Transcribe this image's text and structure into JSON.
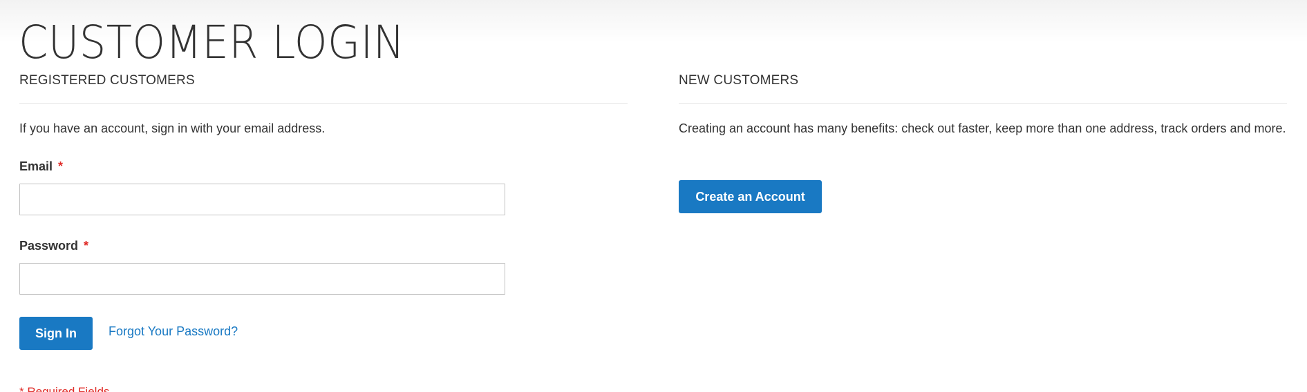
{
  "page": {
    "title": "CUSTOMER LOGIN"
  },
  "registered": {
    "heading": "REGISTERED CUSTOMERS",
    "intro": "If you have an account, sign in with your email address.",
    "email_label": "Email",
    "password_label": "Password",
    "required_symbol": "*",
    "email_value": "",
    "password_value": "",
    "sign_in_label": "Sign In",
    "forgot_label": "Forgot Your Password?",
    "required_note": "* Required Fields"
  },
  "new_customers": {
    "heading": "NEW CUSTOMERS",
    "intro": "Creating an account has many benefits: check out faster, keep more than one address, track orders and more.",
    "create_label": "Create an Account"
  },
  "colors": {
    "accent": "#1979c3",
    "required": "#e02b27",
    "text": "#333333",
    "divider": "#e3e3e3",
    "input_border": "#c2c2c2"
  }
}
